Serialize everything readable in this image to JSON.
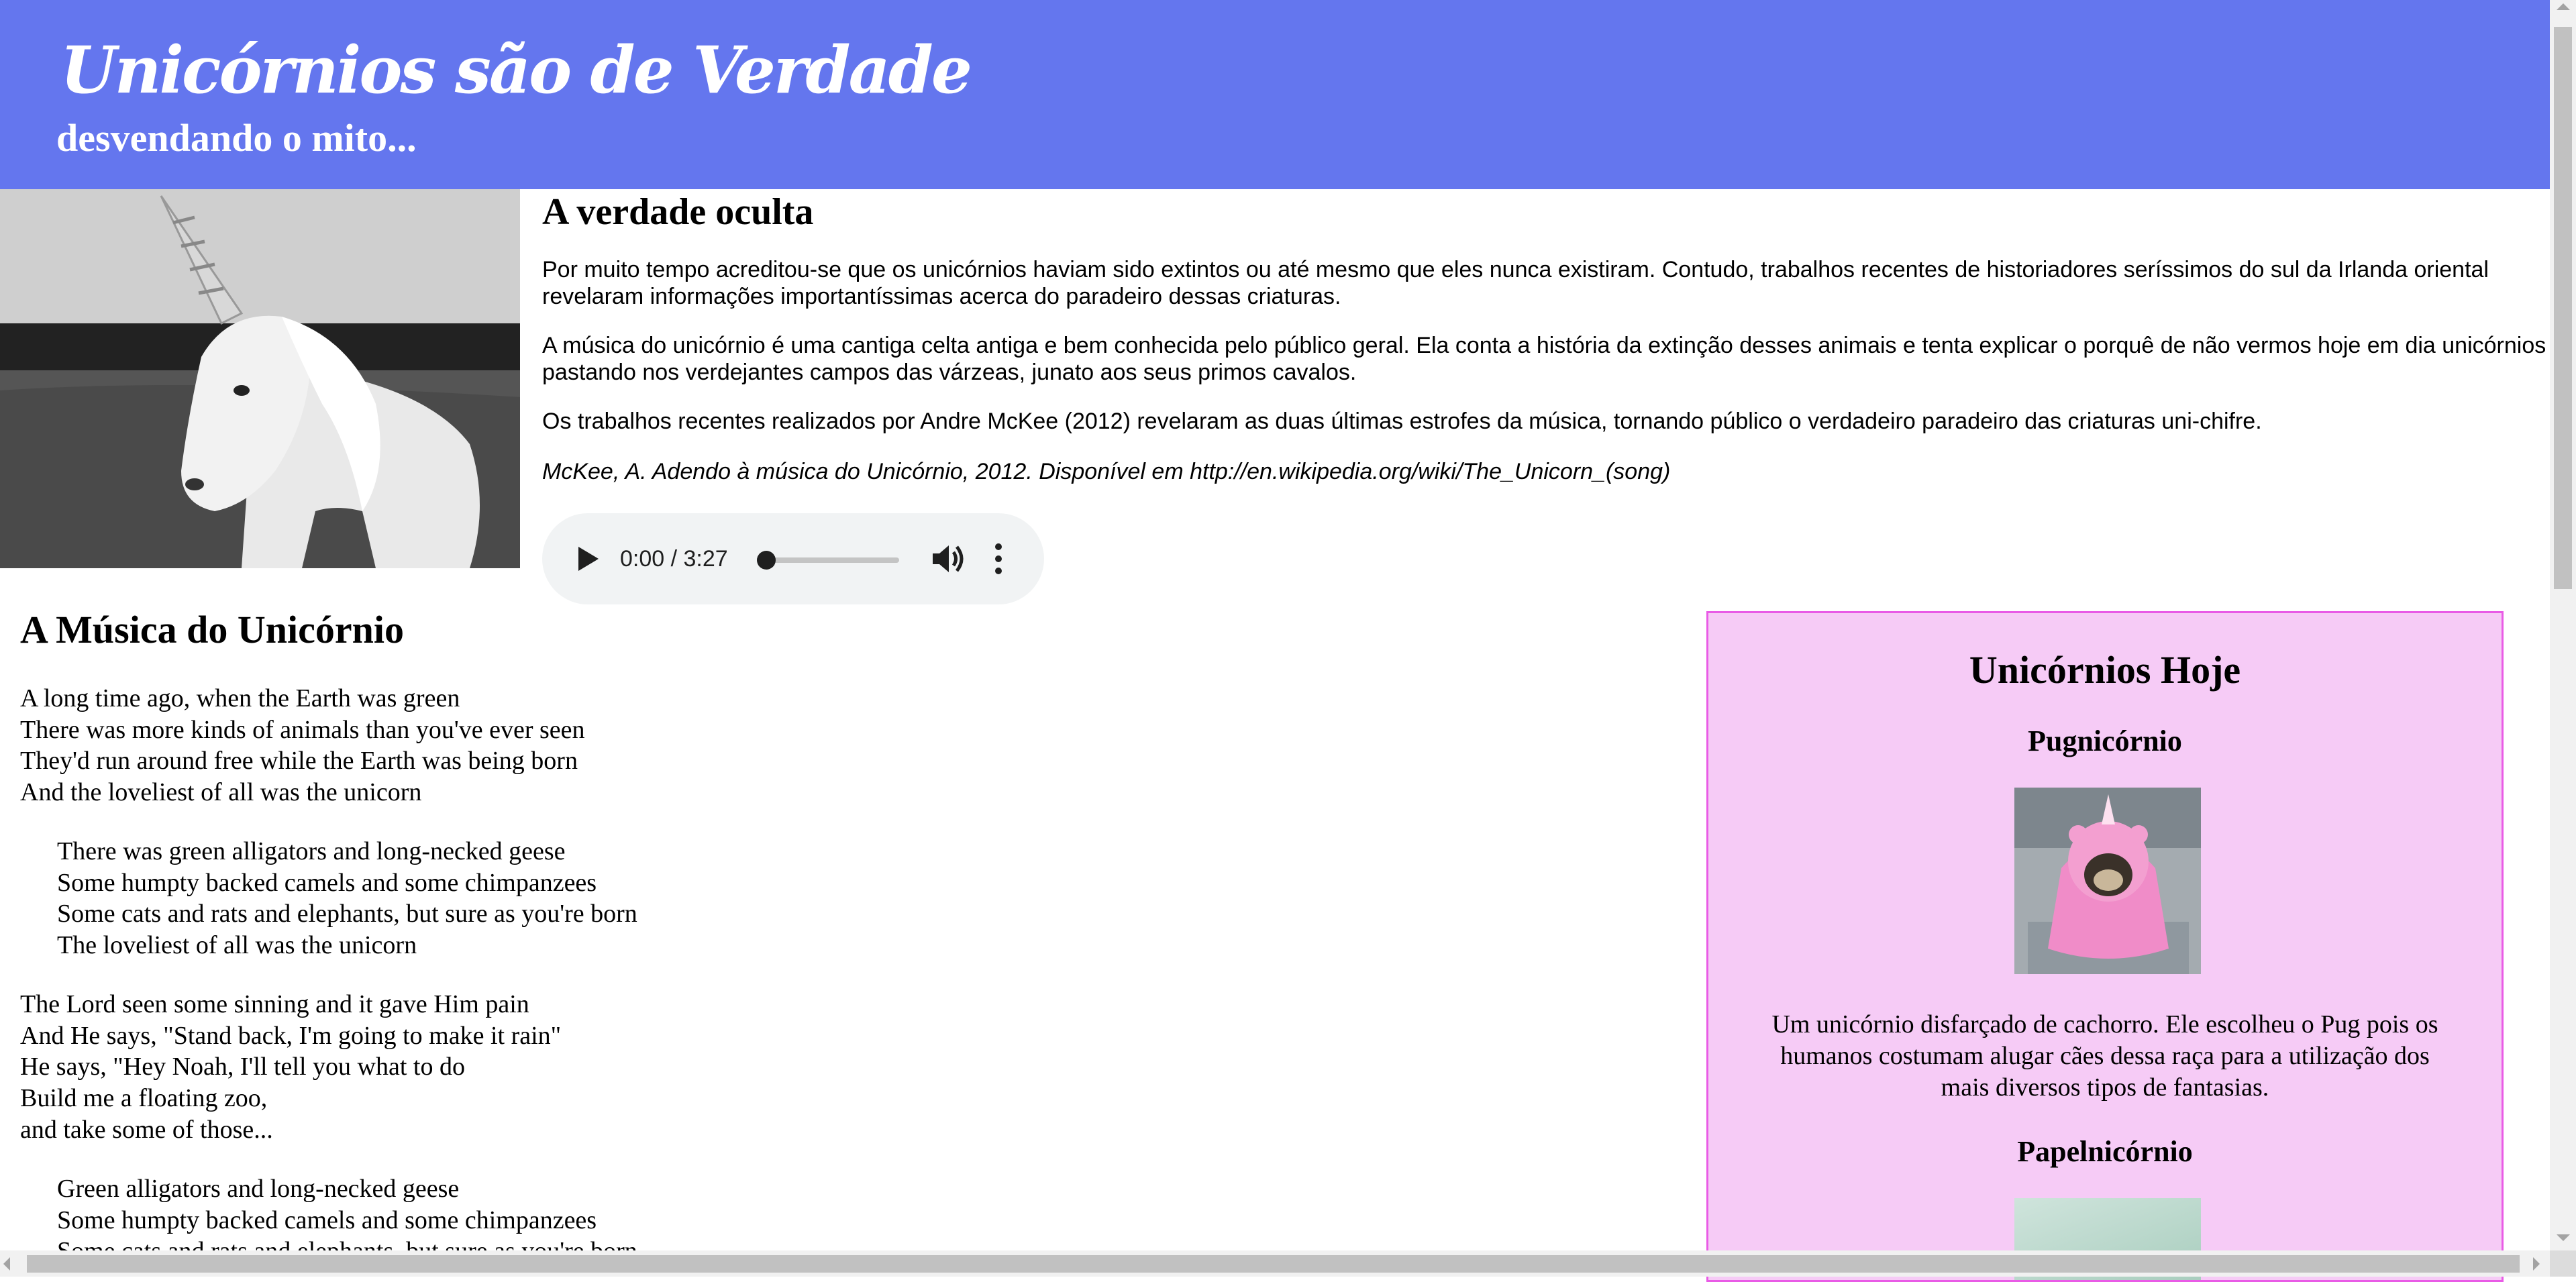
{
  "header": {
    "title": "Unicórnios são de Verdade",
    "subtitle": "desvendando o mito..."
  },
  "colors": {
    "header_bg": "#6476ee",
    "aside_bg": "#f6cbf6",
    "aside_border": "#e95be6",
    "audio_bg": "#f1f3f4"
  },
  "intro": {
    "heading": "A verdade oculta",
    "paragraphs": [
      "Por muito tempo acreditou-se que os unicórnios haviam sido extintos ou até mesmo que eles nunca existiram. Contudo, trabalhos recentes de historiadores seríssimos do sul da Irlanda oriental revelaram informações importantíssimas acerca do paradeiro dessas criaturas.",
      "A música do unicórnio é uma cantiga celta antiga e bem conhecida pelo público geral. Ela conta a história da extinção desses animais e tenta explicar o porquê de não vermos hoje em dia unicórnios pastando nos verdejantes campos das várzeas, junato aos seus primos cavalos.",
      "Os trabalhos recentes realizados por Andre McKee (2012) revelaram as duas últimas estrofes da música, tornando público o verdadeiro paradeiro das criaturas uni-chifre."
    ],
    "citation": "McKee, A. Adendo à música do Unicórnio, 2012. Disponível em http://en.wikipedia.org/wiki/The_Unicorn_(song)"
  },
  "audio": {
    "time": "0:00 / 3:27",
    "play_icon": "play-icon",
    "volume_icon": "volume-icon",
    "more_icon": "more-vertical-icon",
    "progress": 0
  },
  "song": {
    "heading": "A Música do Unicórnio",
    "stanzas": [
      [
        "A long time ago, when the Earth was green",
        "There was more kinds of animals than you've ever seen",
        "They'd run around free while the Earth was being born",
        "And the loveliest of all was the unicorn"
      ],
      [
        "There was green alligators and long-necked geese",
        "Some humpty backed camels and some chimpanzees",
        "Some cats and rats and elephants, but sure as you're born",
        "The loveliest of all was the unicorn"
      ],
      [
        "The Lord seen some sinning and it gave Him pain",
        "And He says, \"Stand back, I'm going to make it rain\"",
        "He says, \"Hey Noah, I'll tell you what to do",
        "Build me a floating zoo,",
        "and take some of those..."
      ],
      [
        "Green alligators and long-necked geese",
        "Some humpty backed camels and some chimpanzees",
        "Some cats and rats and elephants, but sure as you're born"
      ]
    ]
  },
  "aside": {
    "heading": "Unicórnios Hoje",
    "items": [
      {
        "title": "Pugnicórnio",
        "description": "Um unicórnio disfarçado de cachorro. Ele escolheu o Pug pois os humanos costumam alugar cães dessa raça para a utilização dos mais diversos tipos de fantasias."
      },
      {
        "title": "Papelnicórnio"
      }
    ]
  }
}
